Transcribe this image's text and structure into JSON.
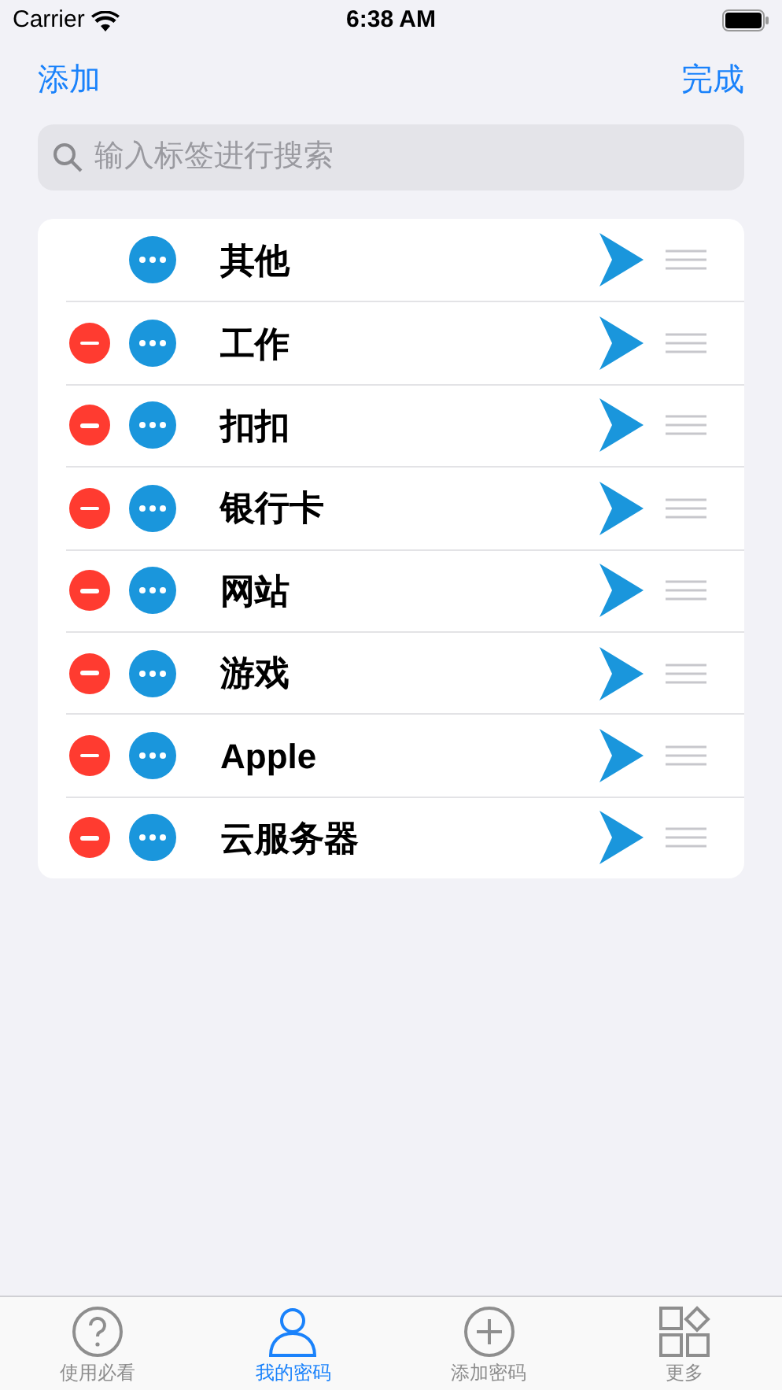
{
  "status_bar": {
    "carrier": "Carrier",
    "time": "6:38 AM"
  },
  "nav": {
    "left": "添加",
    "right": "完成"
  },
  "search": {
    "placeholder": "输入标签进行搜索"
  },
  "rows": [
    {
      "label": "其他",
      "deletable": false
    },
    {
      "label": "工作",
      "deletable": true
    },
    {
      "label": "扣扣",
      "deletable": true
    },
    {
      "label": "银行卡",
      "deletable": true
    },
    {
      "label": "网站",
      "deletable": true
    },
    {
      "label": "游戏",
      "deletable": true
    },
    {
      "label": "Apple",
      "deletable": true
    },
    {
      "label": "云服务器",
      "deletable": true
    }
  ],
  "tabs": [
    {
      "label": "使用必看",
      "kind": "help",
      "selected": false
    },
    {
      "label": "我的密码",
      "kind": "person",
      "selected": true
    },
    {
      "label": "添加密码",
      "kind": "add",
      "selected": false
    },
    {
      "label": "更多",
      "kind": "more",
      "selected": false
    }
  ]
}
